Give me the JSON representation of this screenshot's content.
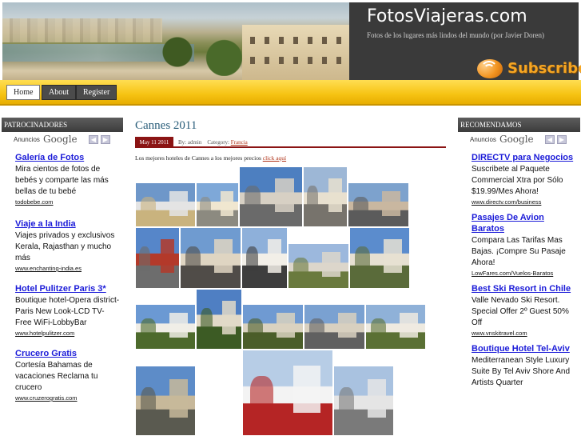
{
  "header": {
    "site_title": "FotosViajeras.com",
    "tagline": "Fotos de los lugares más lindos del mundo (por Javier Doren)",
    "subscribe": "Subscribe"
  },
  "nav": {
    "items": [
      {
        "label": "Home",
        "active": true
      },
      {
        "label": "About",
        "active": false
      },
      {
        "label": "Register",
        "active": false
      }
    ]
  },
  "sidebar_left": {
    "title": "PATROCINADORES",
    "ads_label": "Anuncios",
    "ads_brand": "Google",
    "ads": [
      {
        "title": "Galería de Fotos",
        "body": "Mira cientos de fotos de bebés y comparte las más bellas de tu bebé",
        "url": "todobebe.com"
      },
      {
        "title": "Viaje a la India",
        "body": "Viajes privados y exclusivos Kerala, Rajasthan y mucho más",
        "url": "www.enchanting-india.es"
      },
      {
        "title": "Hotel Pulitzer Paris 3*",
        "body": "Boutique hotel-Opera district-Paris New Look-LCD TV-Free WiFi-LobbyBar",
        "url": "www.hotelpulitzer.com"
      },
      {
        "title": "Crucero Gratis",
        "body": "Cortesía Bahamas de vacaciones Reclama tu crucero",
        "url": "www.cruzerogratis.com"
      }
    ]
  },
  "sidebar_right": {
    "title": "RECOMENDAMOS",
    "ads_label": "Anuncios",
    "ads_brand": "Google",
    "ads": [
      {
        "title": "DIRECTV para Negocios",
        "body": "Suscribete al Paquete Commercial Xtra por Sólo $19.99/Mes Ahora!",
        "url": "www.directv.com/business"
      },
      {
        "title": "Pasajes De Avion Baratos",
        "body": "Compara Las Tarifas Mas Bajas. ¡Compre Su Pasaje Ahora!",
        "url": "LowFares.com/Vuelos-Baratos"
      },
      {
        "title": "Best Ski Resort in Chile",
        "body": "Valle Nevado Ski Resort. Special Offer 2º Guest 50% Off",
        "url": "www.vnskitravel.com"
      },
      {
        "title": "Boutique Hotel Tel-Aviv",
        "body": "Mediterranean Style Luxury Suite By Tel Aviv Shore And Artists Quarter",
        "url": ""
      }
    ]
  },
  "post": {
    "title": "Cannes 2011",
    "date": "May 11 2011",
    "meta_by": "By: admin",
    "meta_category": "Category:",
    "category_link": "Francia",
    "intro": "Los mejores hoteles de Cannes a los mejores precios",
    "intro_link": "click aquí",
    "photos": [
      {
        "sky": "#6e97c9",
        "ground": "#c9b37e",
        "accent": "#e4e4e4"
      },
      {
        "sky": "#7ea8d8",
        "ground": "#8c8a80",
        "accent": "#f0e6d0"
      },
      {
        "sky": "#4d7fc0",
        "ground": "#6a6a6a",
        "accent": "#d7d0c4"
      },
      {
        "sky": "#9db7d6",
        "ground": "#77736c",
        "accent": "#e8e0cf"
      },
      {
        "sky": "#7da2cd",
        "ground": "#5b5b5b",
        "accent": "#c9b7a0"
      },
      {
        "sky": "#5686c9",
        "ground": "#6d6d6d",
        "accent": "#b33a2a"
      },
      {
        "sky": "#6f9bd0",
        "ground": "#504c48",
        "accent": "#dfd5c2"
      },
      {
        "sky": "#8eb0da",
        "ground": "#3e3e3e",
        "accent": "#f2efe8"
      },
      {
        "sky": "#9cb8dd",
        "ground": "#6a7a3e",
        "accent": "#dcd6cb"
      },
      {
        "sky": "#5b8ccd",
        "ground": "#5a6b3a",
        "accent": "#e6e0d2"
      },
      {
        "sky": "#6b99d3",
        "ground": "#4d6a2c",
        "accent": "#f0ede6"
      },
      {
        "sky": "#4f7fc3",
        "ground": "#3c5b24",
        "accent": "#e1d9c8"
      },
      {
        "sky": "#6f9ad2",
        "ground": "#4b5e2a",
        "accent": "#d9d2c0"
      },
      {
        "sky": "#7aa1d1",
        "ground": "#606060",
        "accent": "#d8d0c0"
      },
      {
        "sky": "#8fb1d8",
        "ground": "#5a7034",
        "accent": "#eeeae0"
      },
      {
        "sky": "#b7cde6",
        "ground": "#b52525",
        "accent": "#f3f3f3"
      },
      {
        "sky": "#5d8cc8",
        "ground": "#5a5a50",
        "accent": "#c7b89a"
      },
      {
        "sky": "#a9c2e0",
        "ground": "#7a7a7a",
        "accent": "#e5e5e5"
      }
    ]
  }
}
